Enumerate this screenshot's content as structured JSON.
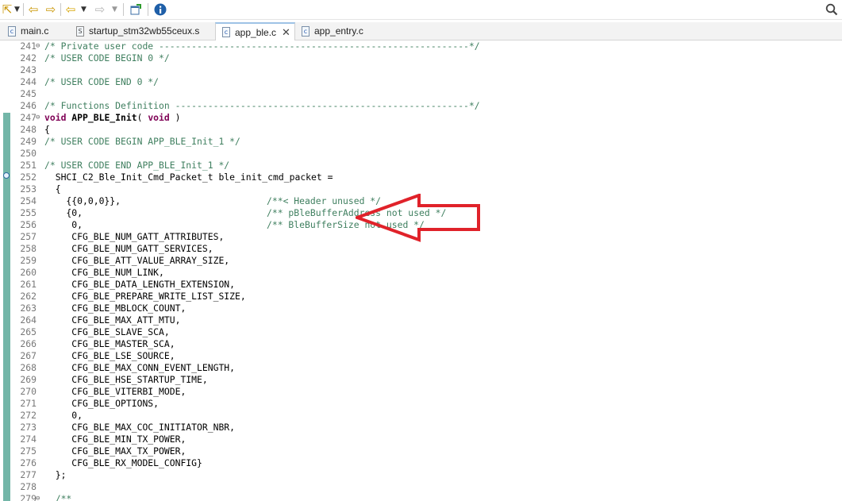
{
  "toolbar": {
    "items": [
      "launch-icon",
      "back-history-icon",
      "forward-history-icon",
      "back-arrow-icon",
      "forward-arrow-icon",
      "new-window-icon",
      "info-icon",
      "search-icon"
    ]
  },
  "tabs": [
    {
      "label": "main.c",
      "icon": "c-file-icon",
      "active": false
    },
    {
      "label": "startup_stm32wb55ceux.s",
      "icon": "s-file-icon",
      "active": false
    },
    {
      "label": "app_ble.c",
      "icon": "c-file-icon",
      "active": true,
      "close": "✕"
    },
    {
      "label": "app_entry.c",
      "icon": "c-file-icon",
      "active": false
    }
  ],
  "editor": {
    "lines": [
      {
        "n": "241",
        "fold": "⊖",
        "text": "/* Private user code ---------------------------------------------------------*/"
      },
      {
        "n": "242",
        "fold": "",
        "text": "/* USER CODE BEGIN 0 */"
      },
      {
        "n": "243",
        "fold": "",
        "text": ""
      },
      {
        "n": "244",
        "fold": "",
        "text": "/* USER CODE END 0 */"
      },
      {
        "n": "245",
        "fold": "",
        "text": ""
      },
      {
        "n": "246",
        "fold": "",
        "text": "/* Functions Definition ------------------------------------------------------*/"
      },
      {
        "n": "247",
        "fold": "⊖",
        "text": "void APP_BLE_Init( void )"
      },
      {
        "n": "248",
        "fold": "",
        "text": "{"
      },
      {
        "n": "249",
        "fold": "",
        "text": "/* USER CODE BEGIN APP_BLE_Init_1 */"
      },
      {
        "n": "250",
        "fold": "",
        "text": ""
      },
      {
        "n": "251",
        "fold": "",
        "text": "/* USER CODE END APP_BLE_Init_1 */"
      },
      {
        "n": "252",
        "fold": "",
        "text": "  SHCI_C2_Ble_Init_Cmd_Packet_t ble_init_cmd_packet ="
      },
      {
        "n": "253",
        "fold": "",
        "text": "  {"
      },
      {
        "n": "254",
        "fold": "",
        "text": "    {{0,0,0}},",
        "comment": "/**< Header unused */"
      },
      {
        "n": "255",
        "fold": "",
        "text": "    {0,",
        "comment": "/** pBleBufferAddress not used */"
      },
      {
        "n": "256",
        "fold": "",
        "text": "     0,",
        "comment": "/** BleBufferSize not used */"
      },
      {
        "n": "257",
        "fold": "",
        "text": "     CFG_BLE_NUM_GATT_ATTRIBUTES,"
      },
      {
        "n": "258",
        "fold": "",
        "text": "     CFG_BLE_NUM_GATT_SERVICES,"
      },
      {
        "n": "259",
        "fold": "",
        "text": "     CFG_BLE_ATT_VALUE_ARRAY_SIZE,"
      },
      {
        "n": "260",
        "fold": "",
        "text": "     CFG_BLE_NUM_LINK,"
      },
      {
        "n": "261",
        "fold": "",
        "text": "     CFG_BLE_DATA_LENGTH_EXTENSION,"
      },
      {
        "n": "262",
        "fold": "",
        "text": "     CFG_BLE_PREPARE_WRITE_LIST_SIZE,"
      },
      {
        "n": "263",
        "fold": "",
        "text": "     CFG_BLE_MBLOCK_COUNT,"
      },
      {
        "n": "264",
        "fold": "",
        "text": "     CFG_BLE_MAX_ATT_MTU,"
      },
      {
        "n": "265",
        "fold": "",
        "text": "     CFG_BLE_SLAVE_SCA,"
      },
      {
        "n": "266",
        "fold": "",
        "text": "     CFG_BLE_MASTER_SCA,"
      },
      {
        "n": "267",
        "fold": "",
        "text": "     CFG_BLE_LSE_SOURCE,"
      },
      {
        "n": "268",
        "fold": "",
        "text": "     CFG_BLE_MAX_CONN_EVENT_LENGTH,"
      },
      {
        "n": "269",
        "fold": "",
        "text": "     CFG_BLE_HSE_STARTUP_TIME,"
      },
      {
        "n": "270",
        "fold": "",
        "text": "     CFG_BLE_VITERBI_MODE,"
      },
      {
        "n": "271",
        "fold": "",
        "text": "     CFG_BLE_OPTIONS,"
      },
      {
        "n": "272",
        "fold": "",
        "text": "     0,"
      },
      {
        "n": "273",
        "fold": "",
        "text": "     CFG_BLE_MAX_COC_INITIATOR_NBR,"
      },
      {
        "n": "274",
        "fold": "",
        "text": "     CFG_BLE_MIN_TX_POWER,"
      },
      {
        "n": "275",
        "fold": "",
        "text": "     CFG_BLE_MAX_TX_POWER,"
      },
      {
        "n": "276",
        "fold": "",
        "text": "     CFG_BLE_RX_MODEL_CONFIG}"
      },
      {
        "n": "277",
        "fold": "",
        "text": "  };"
      },
      {
        "n": "278",
        "fold": "",
        "text": ""
      },
      {
        "n": "279",
        "fold": "⊖",
        "text": "  /**"
      }
    ]
  },
  "colors": {
    "comment": "#3f7f5f",
    "keyword": "#7f0055",
    "line_number": "#787878",
    "annotation_arrow": "#e0222a",
    "change_ruler": "#73b6a8"
  }
}
